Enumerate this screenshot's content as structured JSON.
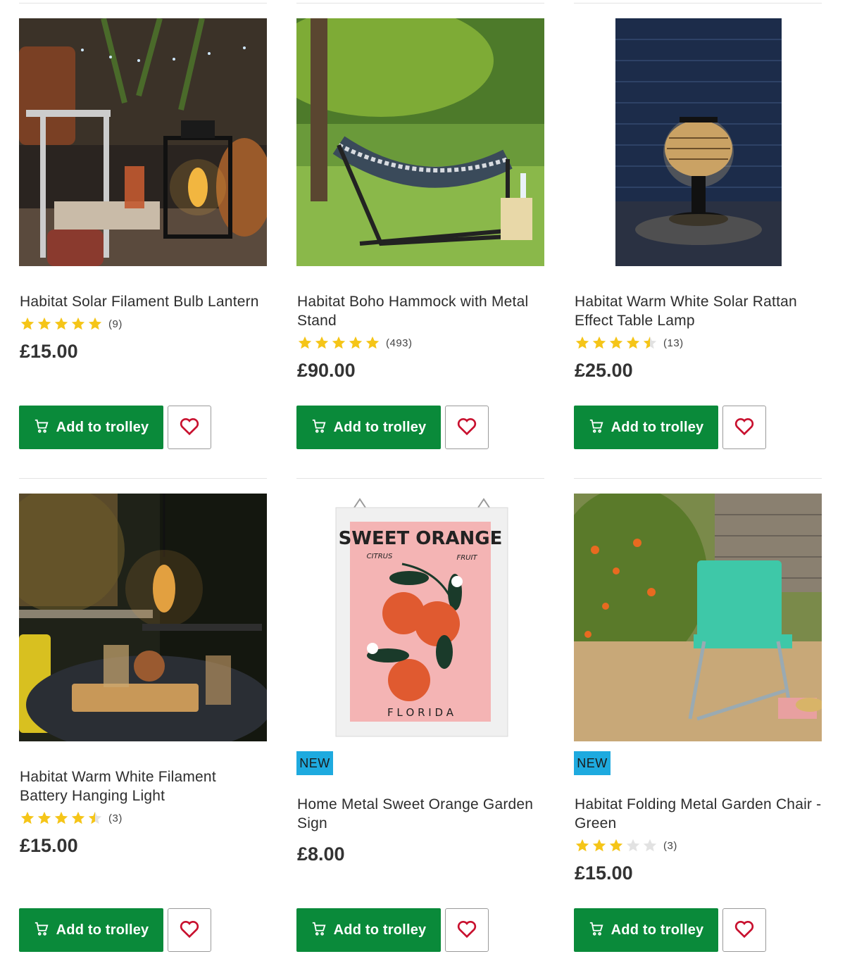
{
  "products": [
    {
      "title": "Habitat Solar Filament Bulb Lantern",
      "rating": 5,
      "review_count": "(9)",
      "price": "£15.00",
      "badge": "",
      "cta": "Add to trolley"
    },
    {
      "title": "Habitat Boho Hammock with Metal Stand",
      "rating": 5,
      "review_count": "(493)",
      "price": "£90.00",
      "badge": "",
      "cta": "Add to trolley"
    },
    {
      "title": "Habitat Warm White Solar Rattan Effect Table Lamp",
      "rating": 4.5,
      "review_count": "(13)",
      "price": "£25.00",
      "badge": "",
      "cta": "Add to trolley"
    },
    {
      "title": "Habitat Warm White Filament Battery Hanging Light",
      "rating": 4.5,
      "review_count": "(3)",
      "price": "£15.00",
      "badge": "",
      "cta": "Add to trolley"
    },
    {
      "title": "Home Metal Sweet Orange Garden Sign",
      "rating": null,
      "review_count": "",
      "price": "£8.00",
      "badge": "NEW",
      "cta": "Add to trolley"
    },
    {
      "title": "Habitat Folding Metal Garden Chair - Green",
      "rating": 3,
      "review_count": "(3)",
      "price": "£15.00",
      "badge": "NEW",
      "cta": "Add to trolley"
    }
  ],
  "sign_artwork": {
    "heading": "SWEET ORANGE",
    "left_word": "CITRUS",
    "right_word": "FRUIT",
    "footer": "F L O R I D A"
  },
  "colors": {
    "brand_green": "#0a8a3a",
    "badge_blue": "#1eaadf",
    "star_gold": "#f5c518",
    "heart_red": "#c8102e"
  },
  "icons": {
    "cart": "cart-icon",
    "heart": "heart-icon",
    "star": "star-icon"
  }
}
